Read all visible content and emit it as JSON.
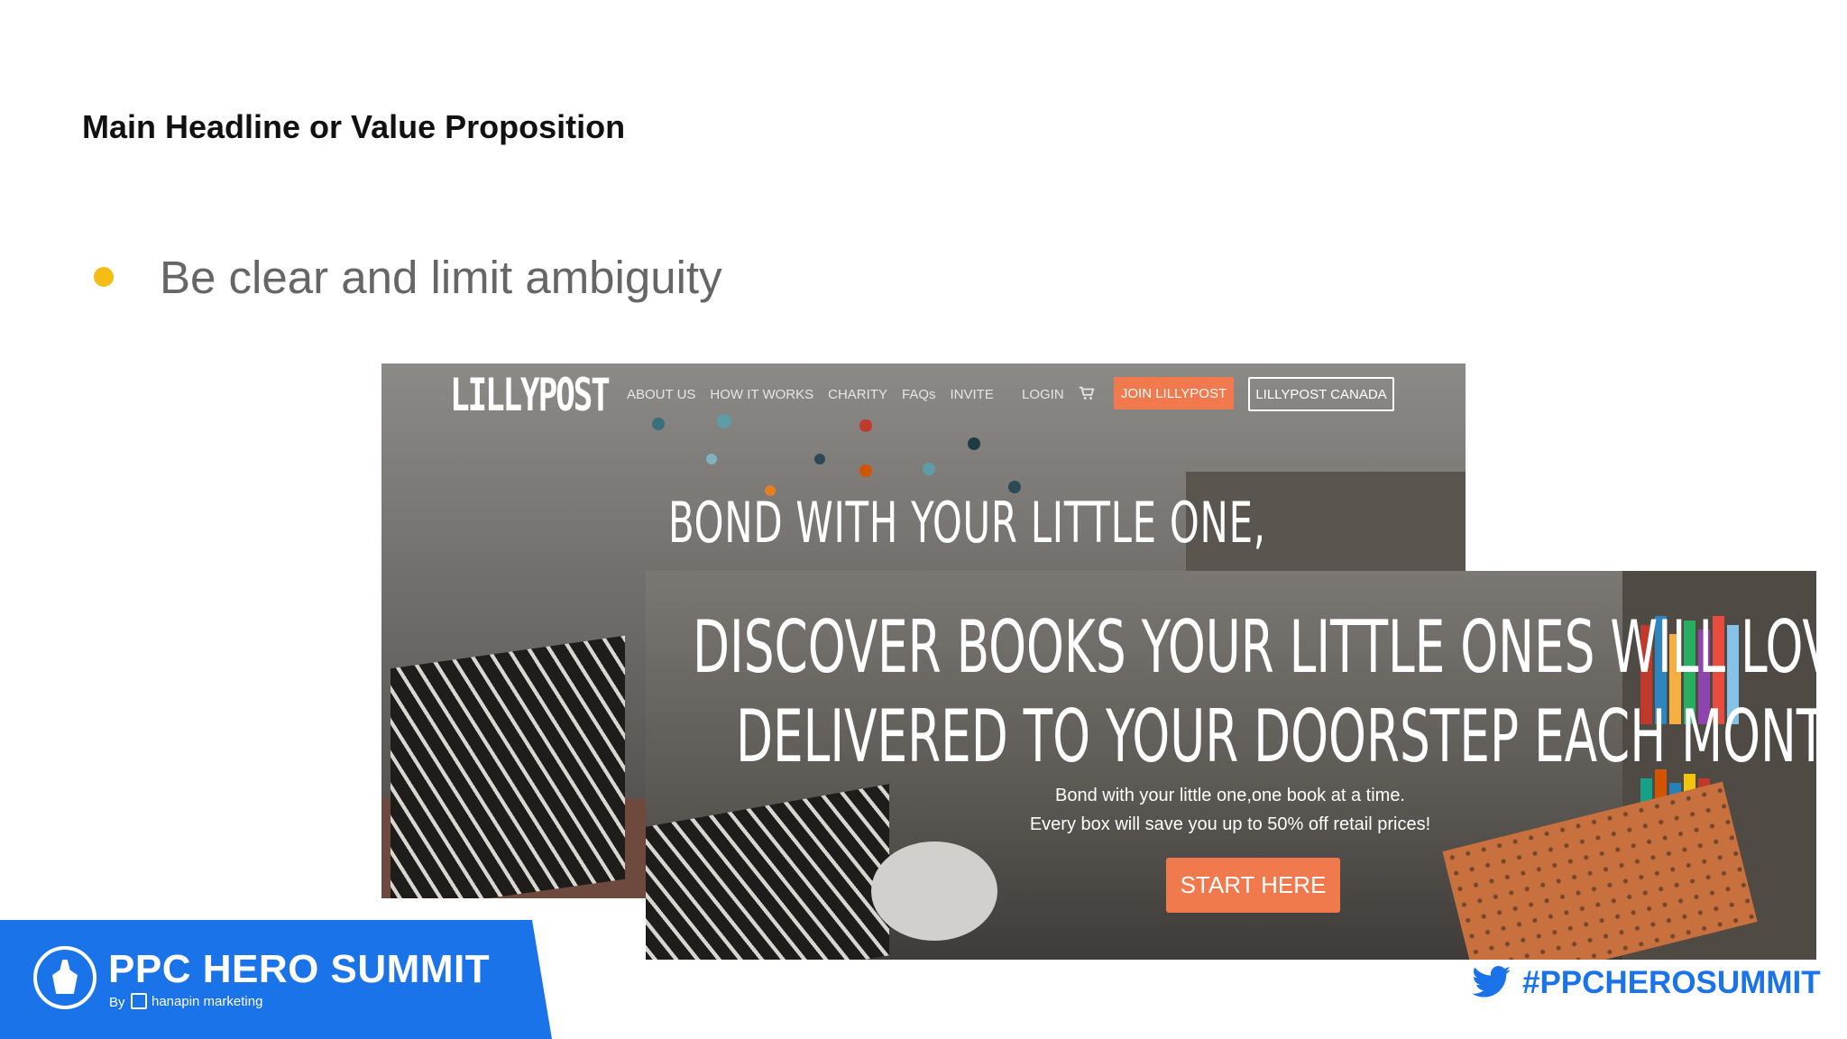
{
  "slide": {
    "title": "Main Headline or Value Proposition",
    "bullet": "Be clear and limit ambiguity"
  },
  "back_screenshot": {
    "logo": "LILLYPOST",
    "nav_links": [
      "ABOUT US",
      "HOW IT WORKS",
      "CHARITY",
      "FAQs",
      "INVITE"
    ],
    "login": "LOGIN",
    "join_button": "JOIN LILLYPOST",
    "canada_button": "LILLYPOST CANADA",
    "headline": "BOND WITH YOUR LITTLE ONE,"
  },
  "front_screenshot": {
    "headline_line1": "DISCOVER BOOKS YOUR LITTLE ONES WILL LOVE,",
    "headline_line2": "DELIVERED TO YOUR DOORSTEP EACH MONTH.",
    "subtext_line1": "Bond with your little one,one book at a time.",
    "subtext_line2": "Every box will save you up to 50% off retail prices!",
    "cta_button": "START HERE"
  },
  "footer": {
    "brand_title": "PPC HERO SUMMIT",
    "brand_by": "By",
    "brand_company": "hanapin marketing",
    "hashtag": "#PPCHEROSUMMIT"
  },
  "colors": {
    "bullet": "#f4bd16",
    "accent_orange": "#f07a4e",
    "brand_blue": "#1a73e8"
  },
  "icons": [
    "cart-icon",
    "twitter-icon",
    "ppc-hero-logo-icon",
    "hanapin-logo-icon"
  ]
}
